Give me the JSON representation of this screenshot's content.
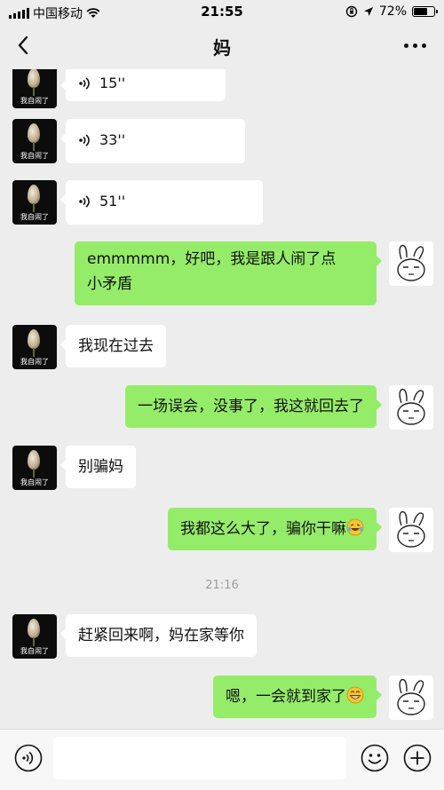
{
  "status": {
    "carrier": "中国移动",
    "time": "21:55",
    "battery": "72%",
    "battery_level": 0.72
  },
  "nav": {
    "title": "妈",
    "back_icon": "chevron-left-icon",
    "more_icon": "more-dots-icon"
  },
  "contact_avatar_caption": "我自闹了",
  "messages": [
    {
      "side": "left",
      "type": "voice",
      "duration": "15''"
    },
    {
      "side": "left",
      "type": "voice",
      "duration": "33''"
    },
    {
      "side": "left",
      "type": "voice",
      "duration": "51''"
    },
    {
      "side": "right",
      "type": "text",
      "line1": "emmmmm，好吧，我是跟人闹了点",
      "line2": "小矛盾"
    },
    {
      "side": "left",
      "type": "text",
      "text": "我现在过去"
    },
    {
      "side": "right",
      "type": "text",
      "text": "一场误会，没事了，我这就回去了"
    },
    {
      "side": "left",
      "type": "text",
      "text": "别骗妈"
    },
    {
      "side": "right",
      "type": "text",
      "text": "我都这么大了，骗你干嘛",
      "emoji": "laughing-crying-emoji"
    },
    {
      "side": "left",
      "type": "text",
      "text": "赶紧回来啊，妈在家等你"
    },
    {
      "side": "right",
      "type": "text",
      "text": "嗯，一会就到家了",
      "emoji": "grinning-emoji"
    }
  ],
  "timestamp": "21:16",
  "colors": {
    "sent_bubble": "#95ec69",
    "received_bubble": "#ffffff",
    "background": "#ededed"
  }
}
